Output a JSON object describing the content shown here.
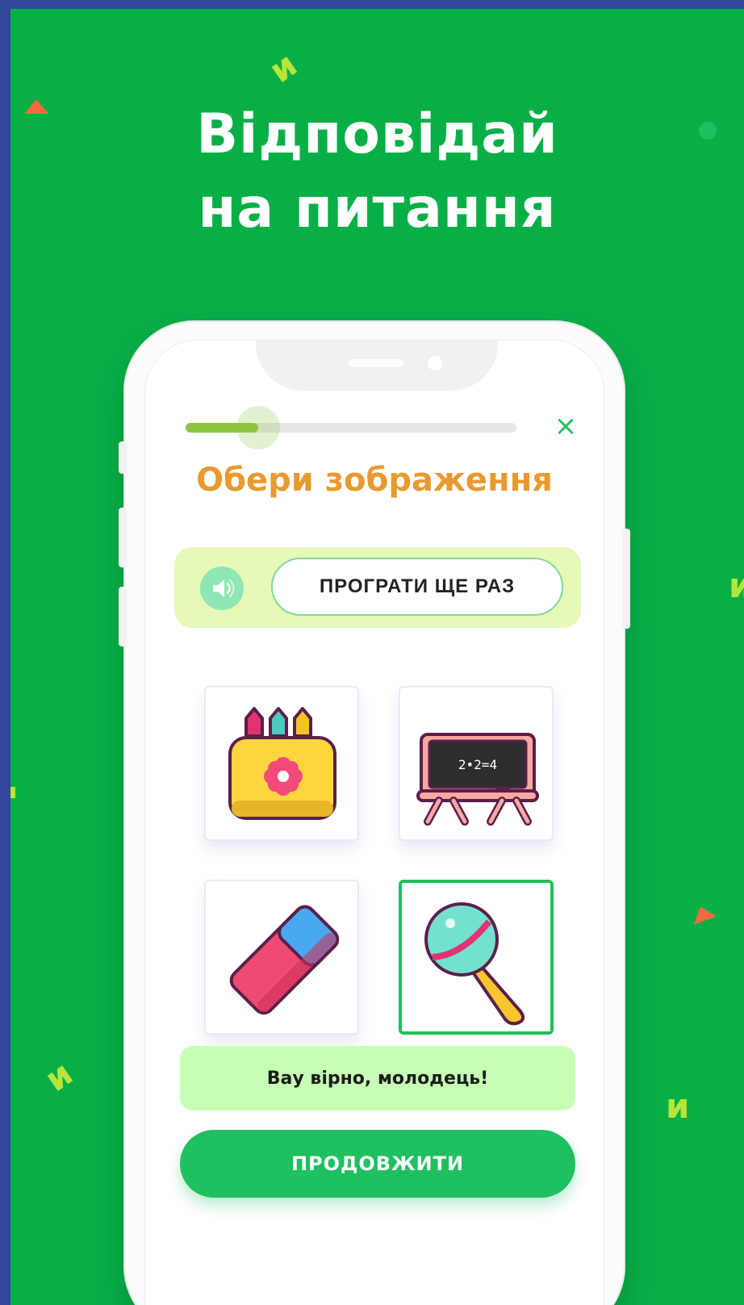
{
  "headline": {
    "line1": "Відповідай",
    "line2": "на питання"
  },
  "decor": {
    "letter": "и"
  },
  "quiz": {
    "progress": 0.22,
    "close_icon": "close-icon",
    "close_glyph": "×",
    "prompt": "Обери зображення",
    "audio": {
      "speaker_icon": "speaker-icon",
      "replay_label": "ПРОГРАТИ ЩЕ РАЗ"
    },
    "options": [
      {
        "name": "pencil-case-icon",
        "selected": false
      },
      {
        "name": "chalkboard-icon",
        "selected": false,
        "board_text": "2•2=4"
      },
      {
        "name": "eraser-icon",
        "selected": false
      },
      {
        "name": "rattle-icon",
        "selected": true
      }
    ],
    "feedback": "Вау вірно, молодець!",
    "continue_label": "ПРОДОВЖИТИ"
  },
  "colors": {
    "background": "#08af47",
    "border": "#2f4899",
    "accent_green": "#1ec05f",
    "title_orange": "#e99a2f",
    "progress": "#8cc63f",
    "feedback_bg": "#c6ffb5",
    "audio_bg": "#e6f9b8"
  }
}
